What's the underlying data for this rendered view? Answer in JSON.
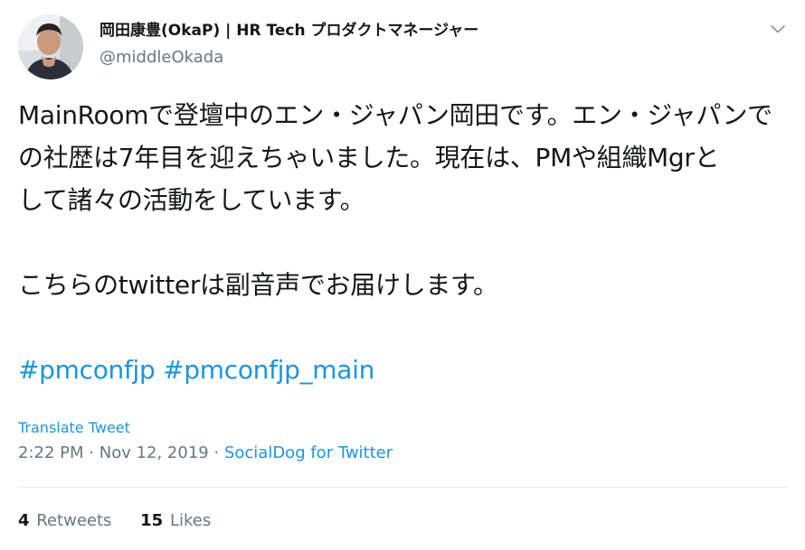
{
  "author": {
    "display_name": "岡田康豊(OkaP) | HR Tech プロダクトマネージャー",
    "handle": "@middleOkada"
  },
  "icons": {
    "avatar": "avatar-photo",
    "menu": "chevron-down-icon"
  },
  "tweet": {
    "line1": "MainRoomで登壇中のエン・ジャパン岡田です。エン・ジャパンで",
    "line2": "の社歴は7年目を迎えちゃいました。現在は、PMや組織Mgrと",
    "line3": "して諸々の活動をしています。",
    "line4": "こちらのtwitterは副音声でお届けします。",
    "hashtags": [
      "#pmconfjp",
      "#pmconfjp_main"
    ]
  },
  "translate_label": "Translate Tweet",
  "meta": {
    "time": "2:22 PM",
    "date": "Nov 12, 2019",
    "separator": "·",
    "source": "SocialDog for Twitter"
  },
  "stats": {
    "retweets_count": "4",
    "retweets_label": "Retweets",
    "likes_count": "15",
    "likes_label": "Likes"
  },
  "colors": {
    "link": "#1b95e0",
    "text": "#14171a",
    "secondary": "#657786",
    "divider": "#e6ecf0"
  }
}
